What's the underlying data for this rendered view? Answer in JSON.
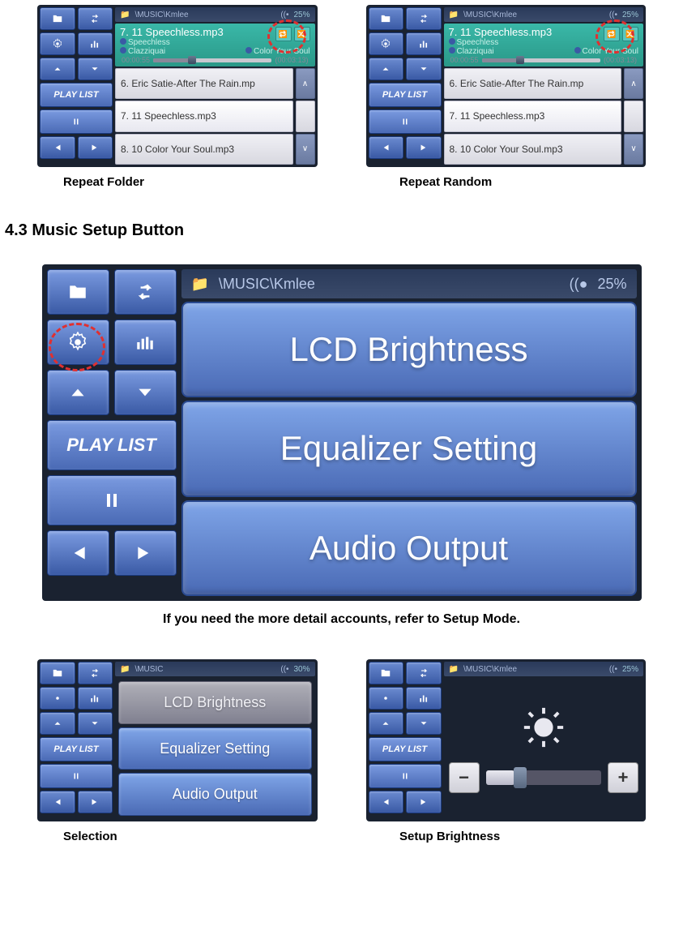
{
  "section_heading": "4.3 Music Setup Button",
  "center_caption": "If you need the more detail accounts, refer to Setup Mode.",
  "captions": {
    "repeat_folder": "Repeat Folder",
    "repeat_random": "Repeat Random",
    "selection": "Selection",
    "setup_brightness": "Setup Brightness"
  },
  "status": {
    "path": "\\MUSIC\\Kmlee",
    "volume": "25%",
    "volume_alt": "30%"
  },
  "now_playing": {
    "title": "7. 11 Speechless.mp3",
    "song": "Speechless",
    "artist": "Clazziquai",
    "album": "Color Your Soul",
    "elapsed": "00:00:55",
    "total": "(00:03:13)"
  },
  "playlist_label": "PLAY LIST",
  "tracks": [
    "6. Eric Satie-After The Rain.mp",
    "7. 11 Speechless.mp3",
    "8. 10 Color Your Soul.mp3"
  ],
  "setup_menu": {
    "item1": "LCD Brightness",
    "item2": "Equalizer Setting",
    "item3": "Audio Output"
  },
  "status_path_short": "\\MUSIC",
  "brightness": {
    "minus": "−",
    "plus": "+"
  }
}
